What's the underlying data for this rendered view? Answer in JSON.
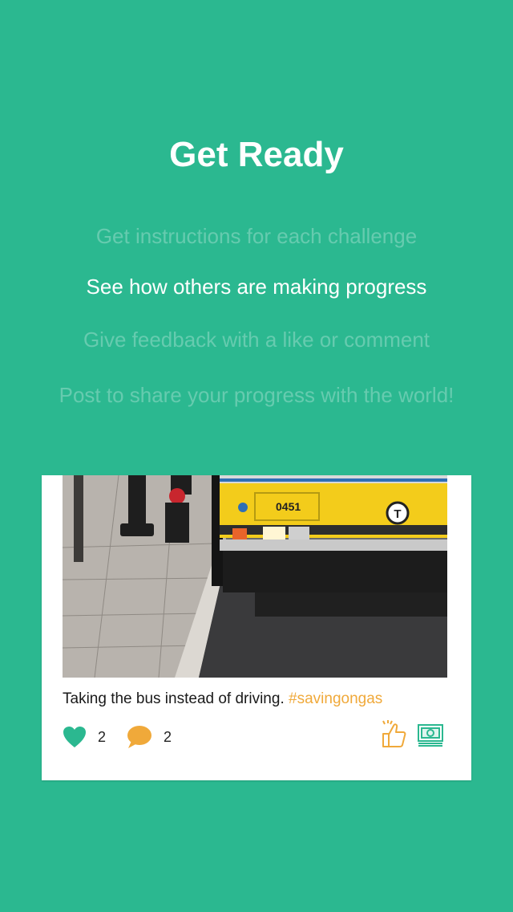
{
  "header": {
    "title": "Get Ready"
  },
  "steps": [
    {
      "label": "Get instructions for each challenge",
      "state": "inactive"
    },
    {
      "label": "See how others are making progress",
      "state": "active"
    },
    {
      "label": "Give feedback with a like or comment",
      "state": "inactive"
    },
    {
      "label": "Post to share your progress with the world!",
      "state": "inactive"
    }
  ],
  "post": {
    "caption": "Taking the bus instead of driving.",
    "hashtag": "#savingongas",
    "bus_number": "0451",
    "likes": "2",
    "comments": "2",
    "icons": [
      "heart-icon",
      "comment-icon",
      "thumbs-up-icon",
      "money-icon"
    ]
  },
  "colors": {
    "background": "#2bb890",
    "heart": "#2bb890",
    "comment": "#f0a93a",
    "hashtag": "#f0a93a"
  }
}
